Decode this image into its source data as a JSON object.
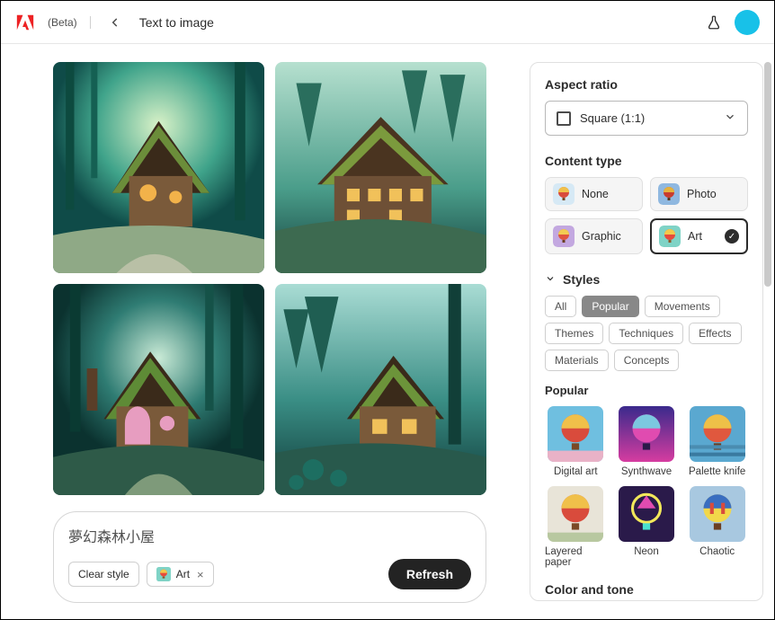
{
  "header": {
    "beta_label": "(Beta)",
    "page_title": "Text to image"
  },
  "prompt": {
    "text": "夢幻森林小屋",
    "clear_style_label": "Clear style",
    "chip_label": "Art",
    "refresh_label": "Refresh"
  },
  "panel": {
    "aspect_ratio_title": "Aspect ratio",
    "aspect_ratio_value": "Square (1:1)",
    "content_type_title": "Content type",
    "content_types": [
      {
        "label": "None"
      },
      {
        "label": "Photo"
      },
      {
        "label": "Graphic"
      },
      {
        "label": "Art",
        "selected": true
      }
    ],
    "styles_title": "Styles",
    "tabs": [
      {
        "label": "All"
      },
      {
        "label": "Popular",
        "active": true
      },
      {
        "label": "Movements"
      },
      {
        "label": "Themes"
      },
      {
        "label": "Techniques"
      },
      {
        "label": "Effects"
      },
      {
        "label": "Materials"
      },
      {
        "label": "Concepts"
      }
    ],
    "popular_title": "Popular",
    "styles": [
      {
        "label": "Digital art"
      },
      {
        "label": "Synthwave"
      },
      {
        "label": "Palette knife"
      },
      {
        "label": "Layered paper"
      },
      {
        "label": "Neon"
      },
      {
        "label": "Chaotic"
      }
    ],
    "color_tone_title": "Color and tone"
  },
  "colors": {
    "accent": "#18c1e8",
    "adobe_red": "#ED2224"
  }
}
